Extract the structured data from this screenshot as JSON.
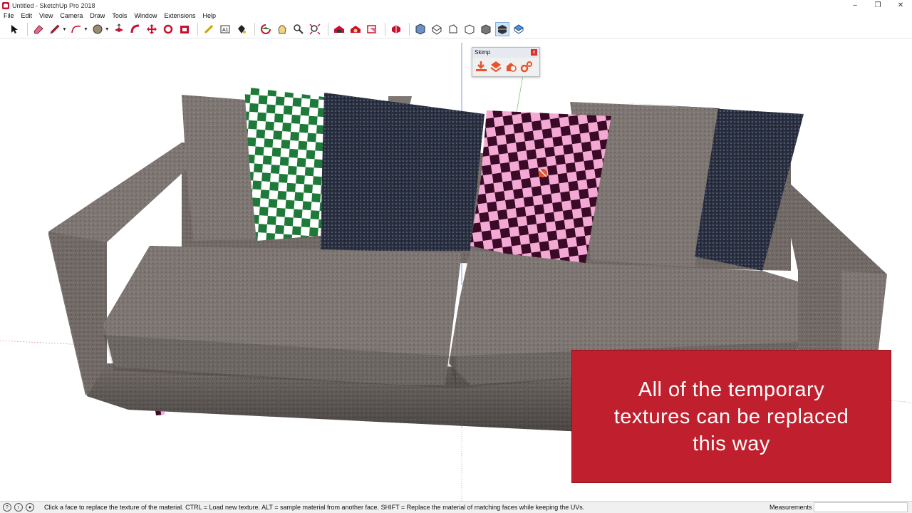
{
  "window": {
    "title": "Untitled - SketchUp Pro 2018",
    "controls": [
      "–",
      "❐",
      "✕"
    ]
  },
  "menu": [
    "File",
    "Edit",
    "View",
    "Camera",
    "Draw",
    "Tools",
    "Window",
    "Extensions",
    "Help"
  ],
  "toolbar": {
    "tools": [
      "select-icon",
      "eraser-icon",
      "pencil-icon",
      "arc-icon",
      "circle-icon",
      "push-pull-icon",
      "follow-me-icon",
      "move-icon",
      "rotate-icon",
      "offset-icon",
      "tape-measure-icon",
      "text-icon",
      "paint-bucket-icon",
      "orbit-icon",
      "pan-icon",
      "zoom-icon",
      "zoom-extents-icon",
      "warehouse-icon",
      "extension-warehouse-icon",
      "layout-icon",
      "extension-manager-icon",
      "iso-view-icon",
      "top-view-icon",
      "front-view-icon",
      "right-view-icon",
      "back-view-icon",
      "left-view-icon",
      "section-plane-icon"
    ]
  },
  "skimp": {
    "title": "Skimp",
    "close": "x",
    "icons": [
      "import-icon",
      "reduce-icon",
      "replace-icon",
      "settings-icon"
    ]
  },
  "caption": {
    "text": "All of the temporary\ntextures can be replaced\nthis way"
  },
  "status": {
    "message": "Click a face to replace the texture of the material. CTRL = Load new texture. ALT = sample material from another face. SHIFT = Replace the material of matching faces while keeping the UVs.",
    "measurements_label": "Measurements",
    "measurements_value": ""
  },
  "colors": {
    "caption_bg": "#c0202d",
    "sofa_fabric": "#6f6864",
    "pillow_green": "#1e7a38",
    "pillow_pink": "#f3a9d4",
    "pillow_navy": "#2e3446"
  }
}
